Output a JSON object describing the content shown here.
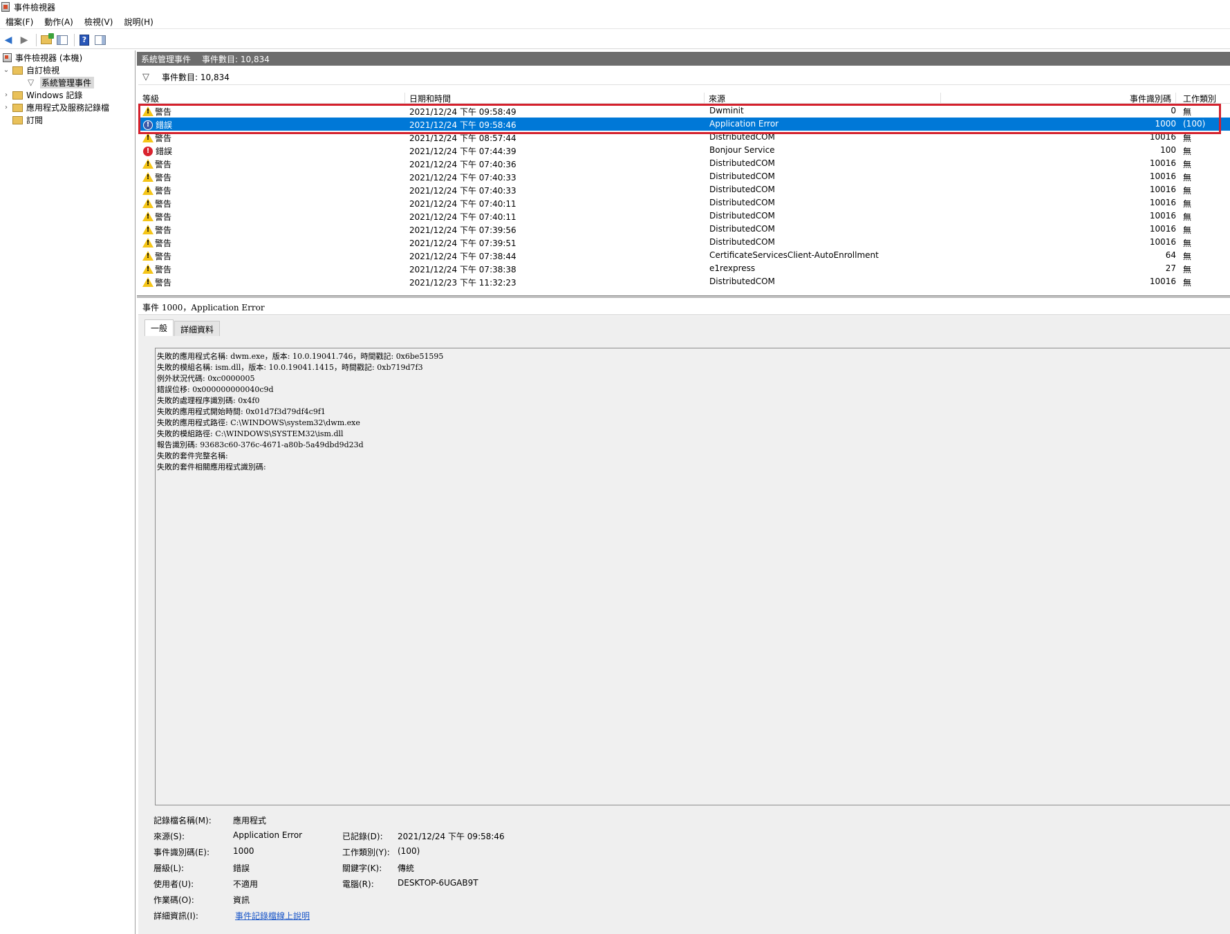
{
  "window": {
    "title": "事件檢視器"
  },
  "menu": {
    "items": [
      "檔案(F)",
      "動作(A)",
      "檢視(V)",
      "說明(H)"
    ]
  },
  "tree": {
    "root": "事件檢視器 (本機)",
    "custom_views": "自訂檢視",
    "admin_events": "系統管理事件",
    "windows_logs": "Windows 記錄",
    "app_service_logs": "應用程式及服務記錄檔",
    "subscriptions": "訂閱"
  },
  "pane_header": {
    "title": "系統管理事件",
    "count": "事件數目: 10,834"
  },
  "filter_bar": {
    "text": "事件數目: 10,834"
  },
  "grid": {
    "columns": [
      "等級",
      "日期和時間",
      "來源",
      "事件識別碼",
      "工作類別"
    ],
    "rows": [
      {
        "level": "警告",
        "type": "warning",
        "datetime": "2021/12/24 下午 09:58:49",
        "source": "Dwminit",
        "event_id": "0",
        "task": "無"
      },
      {
        "level": "錯誤",
        "type": "error",
        "datetime": "2021/12/24 下午 09:58:46",
        "source": "Application Error",
        "event_id": "1000",
        "task": "(100)"
      },
      {
        "level": "警告",
        "type": "warning",
        "datetime": "2021/12/24 下午 08:57:44",
        "source": "DistributedCOM",
        "event_id": "10016",
        "task": "無"
      },
      {
        "level": "錯誤",
        "type": "error",
        "datetime": "2021/12/24 下午 07:44:39",
        "source": "Bonjour Service",
        "event_id": "100",
        "task": "無"
      },
      {
        "level": "警告",
        "type": "warning",
        "datetime": "2021/12/24 下午 07:40:36",
        "source": "DistributedCOM",
        "event_id": "10016",
        "task": "無"
      },
      {
        "level": "警告",
        "type": "warning",
        "datetime": "2021/12/24 下午 07:40:33",
        "source": "DistributedCOM",
        "event_id": "10016",
        "task": "無"
      },
      {
        "level": "警告",
        "type": "warning",
        "datetime": "2021/12/24 下午 07:40:33",
        "source": "DistributedCOM",
        "event_id": "10016",
        "task": "無"
      },
      {
        "level": "警告",
        "type": "warning",
        "datetime": "2021/12/24 下午 07:40:11",
        "source": "DistributedCOM",
        "event_id": "10016",
        "task": "無"
      },
      {
        "level": "警告",
        "type": "warning",
        "datetime": "2021/12/24 下午 07:40:11",
        "source": "DistributedCOM",
        "event_id": "10016",
        "task": "無"
      },
      {
        "level": "警告",
        "type": "warning",
        "datetime": "2021/12/24 下午 07:39:56",
        "source": "DistributedCOM",
        "event_id": "10016",
        "task": "無"
      },
      {
        "level": "警告",
        "type": "warning",
        "datetime": "2021/12/24 下午 07:39:51",
        "source": "DistributedCOM",
        "event_id": "10016",
        "task": "無"
      },
      {
        "level": "警告",
        "type": "warning",
        "datetime": "2021/12/24 下午 07:38:44",
        "source": "CertificateServicesClient-AutoEnrollment",
        "event_id": "64",
        "task": "無"
      },
      {
        "level": "警告",
        "type": "warning",
        "datetime": "2021/12/24 下午 07:38:38",
        "source": "e1rexpress",
        "event_id": "27",
        "task": "無"
      },
      {
        "level": "警告",
        "type": "warning",
        "datetime": "2021/12/23 下午 11:32:23",
        "source": "DistributedCOM",
        "event_id": "10016",
        "task": "無"
      }
    ],
    "selected_index": 1
  },
  "detail": {
    "title": "事件 1000，Application Error",
    "tabs": [
      "一般",
      "詳細資料"
    ],
    "description_lines": [
      "失敗的應用程式名稱: dwm.exe，版本: 10.0.19041.746，時間戳記: 0x6be51595",
      "失敗的模組名稱: ism.dll，版本: 10.0.19041.1415，時間戳記: 0xb719d7f3",
      "例外狀況代碼: 0xc0000005",
      "錯誤位移: 0x000000000040c9d",
      "失敗的處理程序識別碼: 0x4f0",
      "失敗的應用程式開始時間: 0x01d7f3d79df4c9f1",
      "失敗的應用程式路徑: C:\\WINDOWS\\system32\\dwm.exe",
      "失敗的模組路徑: C:\\WINDOWS\\SYSTEM32\\ism.dll",
      "報告識別碼: 93683c60-376c-4671-a80b-5a49dbd9d23d",
      "失敗的套件完整名稱:",
      "失敗的套件相關應用程式識別碼:"
    ],
    "props": {
      "log_name_label": "記錄檔名稱(M):",
      "log_name": "應用程式",
      "source_label": "來源(S):",
      "source": "Application Error",
      "logged_label": "已記錄(D):",
      "logged": "2021/12/24 下午 09:58:46",
      "event_id_label": "事件識別碼(E):",
      "event_id": "1000",
      "task_label": "工作類別(Y):",
      "task": "(100)",
      "level_label": "層級(L):",
      "level": "錯誤",
      "keywords_label": "關鍵字(K):",
      "keywords": "傳統",
      "user_label": "使用者(U):",
      "user": "不適用",
      "computer_label": "電腦(R):",
      "computer": "DESKTOP-6UGAB9T",
      "opcode_label": "作業碼(O):",
      "opcode": "資訊",
      "more_info_label": "詳細資訊(I):",
      "more_info_link": "事件記錄檔線上說明"
    }
  },
  "colors": {
    "selection": "#0078d7",
    "highlight_box": "#d4202c",
    "header_bg": "#6d6d6d"
  }
}
